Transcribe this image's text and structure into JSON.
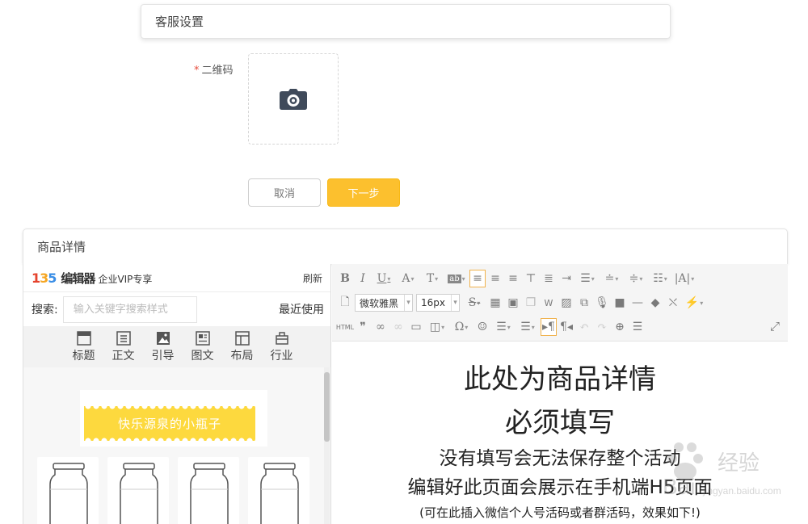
{
  "customer_service": {
    "header": "客服设置",
    "qr_label": "二维码",
    "required_mark": "*",
    "upload_icon": "camera-icon"
  },
  "actions": {
    "cancel": "取消",
    "next": "下一步"
  },
  "product_detail": {
    "header": "商品详情"
  },
  "template_panel": {
    "logo_numbers": [
      "1",
      "3",
      "5"
    ],
    "logo_name": "编辑器",
    "vip": "企业VIP专享",
    "refresh": "刷新",
    "search_label": "搜索:",
    "search_placeholder": "输入关键字搜索样式",
    "recent": "最近使用",
    "categories": [
      {
        "label": "标题",
        "icon": "title-icon"
      },
      {
        "label": "正文",
        "icon": "text-icon"
      },
      {
        "label": "引导",
        "icon": "image-icon"
      },
      {
        "label": "图文",
        "icon": "image-text-icon"
      },
      {
        "label": "布局",
        "icon": "layout-icon"
      },
      {
        "label": "行业",
        "icon": "industry-icon"
      }
    ],
    "banner_text": "快乐源泉的小瓶子"
  },
  "editor": {
    "font_family": "微软雅黑",
    "font_size": "16px",
    "html_label": "HTML",
    "content": {
      "line1": "此处为商品详情",
      "line2": "必须填写",
      "line3": "没有填写会无法保存整个活动",
      "line4": "编辑好此页面会展示在手机端H5页面",
      "line5": "(可在此插入微信个人号活码或者群活码，效果如下!)"
    }
  },
  "watermark": {
    "brand": "Bai",
    "sub": "经验",
    "url": "jingyan.baidu.com"
  },
  "colors": {
    "accent": "#fcc02e",
    "required": "#e74c3c",
    "banner": "#fdd93e"
  }
}
